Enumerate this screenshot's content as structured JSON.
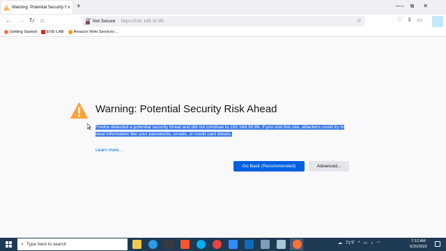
{
  "tab": {
    "title": "Warning: Potential Security Risk",
    "close": "×"
  },
  "newtab": "+",
  "window_controls": {
    "minimize": "—",
    "maximize": "⧉",
    "close": "✕"
  },
  "navbar": {
    "not_secure": "Not Secure",
    "url": "https://192.168.30.99"
  },
  "bookmarks": [
    {
      "label": "Getting Started"
    },
    {
      "label": "EVE-LAB"
    },
    {
      "label": "Amazon Web Services ..."
    }
  ],
  "page": {
    "heading": "Warning: Potential Security Risk Ahead",
    "description": "Firefox detected a potential security threat and did not continue to 192.168.30.99. If you visit this site, attackers could try to steal information like your passwords, emails, or credit card details.",
    "learn_more": "Learn more...",
    "go_back": "Go Back (Recommended)",
    "advanced": "Advanced..."
  },
  "taskbar": {
    "search_placeholder": "Type here to search",
    "weather": "71°F",
    "time": "7:12 AM",
    "date": "5/15/2022"
  },
  "colors": {
    "accent": "#0061e0",
    "selection": "#3b78e7",
    "warning": "#ffa436",
    "taskbar": "#1f3a54"
  }
}
